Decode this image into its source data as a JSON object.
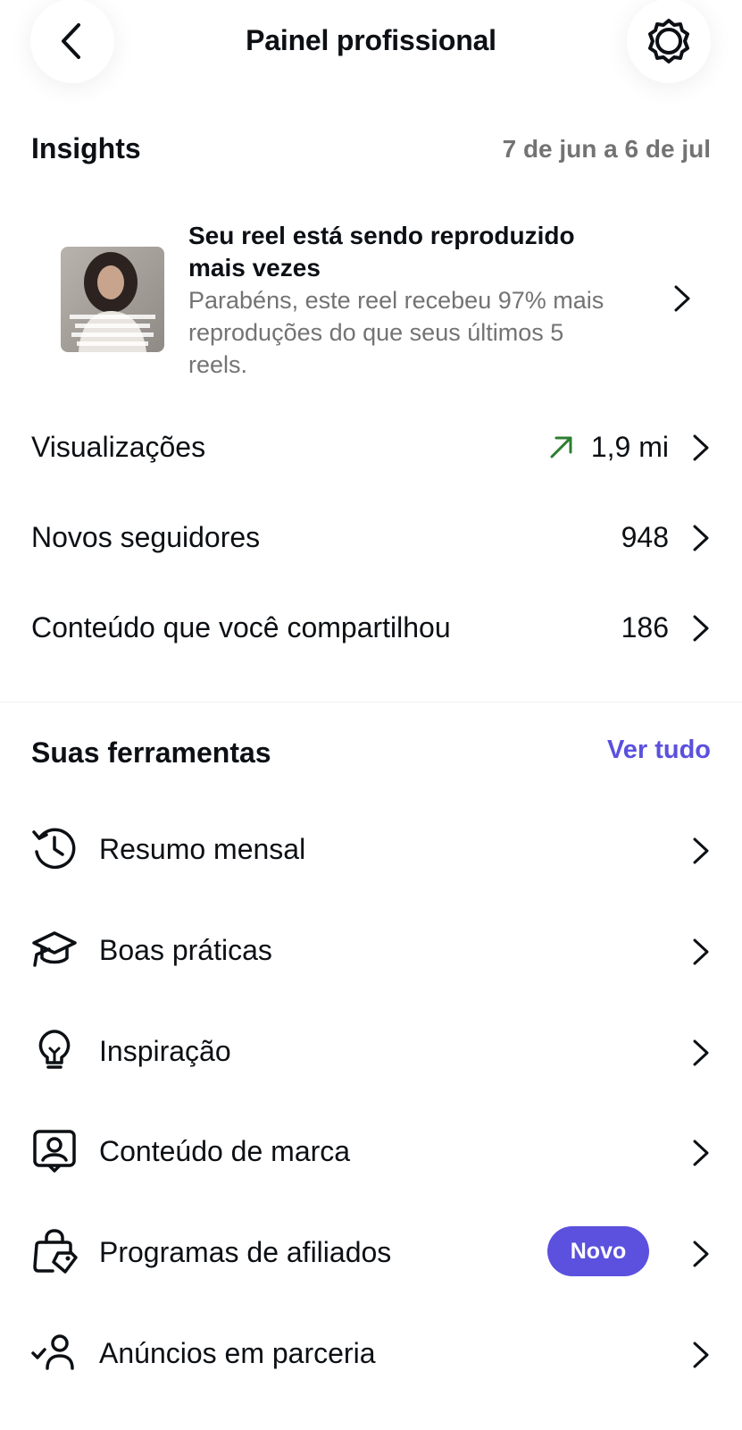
{
  "header": {
    "title": "Painel profissional",
    "back_icon": "chevron-left-icon",
    "settings_icon": "gear-icon"
  },
  "insights": {
    "title": "Insights",
    "date_range": "7 de jun a 6 de jul",
    "reel": {
      "title": "Seu reel está sendo reproduzido mais vezes",
      "description": "Parabéns, este reel recebeu 97% mais reproduções do que seus últimos 5 reels."
    },
    "metrics": [
      {
        "label": "Visualizações",
        "value": "1,9 mi",
        "trend": "up",
        "trend_color": "#2e7d32"
      },
      {
        "label": "Novos seguidores",
        "value": "948"
      },
      {
        "label": "Conteúdo que você compartilhou",
        "value": "186"
      }
    ]
  },
  "tools": {
    "title": "Suas ferramentas",
    "see_all": "Ver tudo",
    "items": [
      {
        "label": "Resumo mensal",
        "icon": "history-icon"
      },
      {
        "label": "Boas práticas",
        "icon": "graduation-cap-icon"
      },
      {
        "label": "Inspiração",
        "icon": "lightbulb-icon"
      },
      {
        "label": "Conteúdo de marca",
        "icon": "branded-content-icon"
      },
      {
        "label": "Programas de afiliados",
        "icon": "shopping-bag-tag-icon",
        "badge": "Novo"
      },
      {
        "label": "Anúncios em parceria",
        "icon": "user-check-icon"
      }
    ]
  },
  "colors": {
    "accent": "#5b51de",
    "text": "#0c1014",
    "secondary_text": "#737373",
    "trend_up": "#2e7d32"
  }
}
